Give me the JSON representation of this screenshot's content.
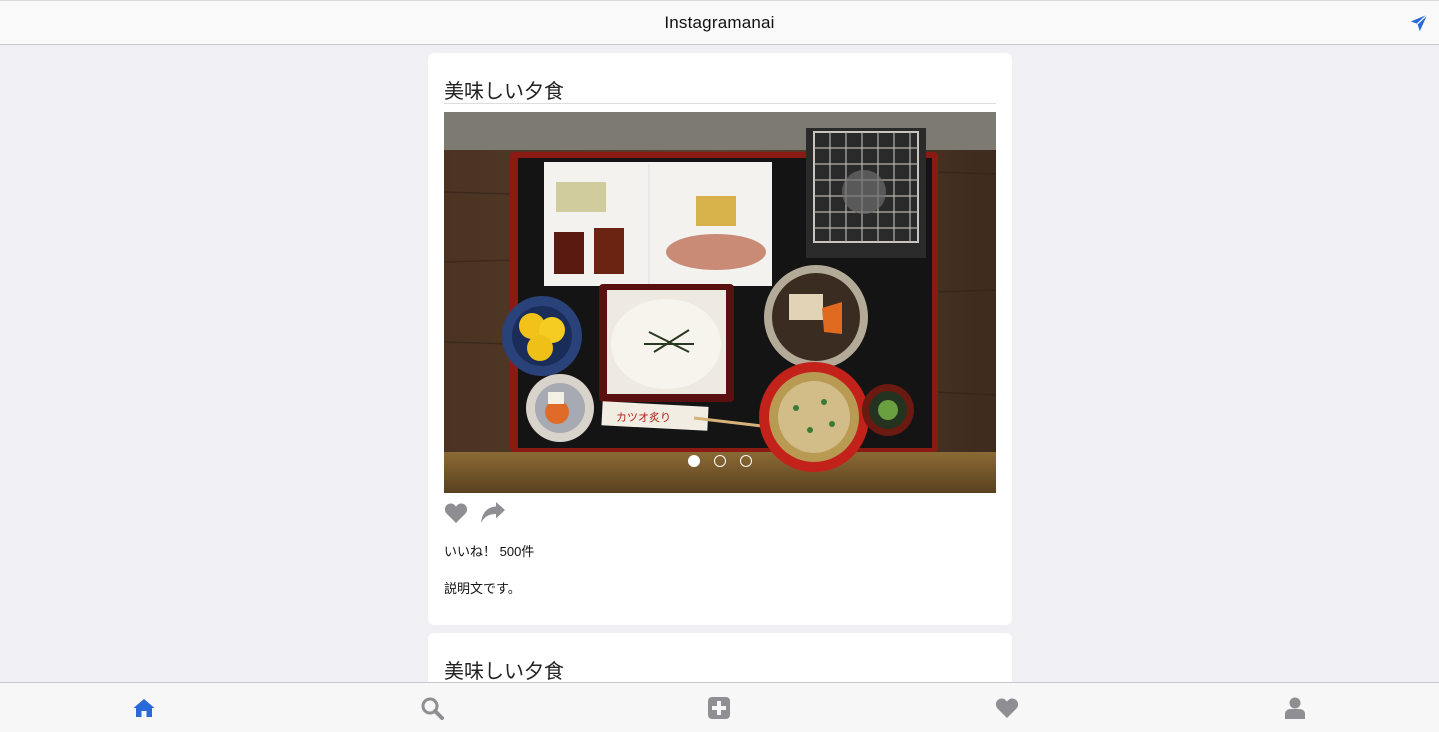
{
  "header": {
    "title": "Instagramanai",
    "send_icon": "paper-plane-icon",
    "accent_color": "#2a6ad8"
  },
  "posts": [
    {
      "title": "美味しい夕食",
      "image": "japanese-set-meal-photo",
      "carousel": {
        "count": 3,
        "active_index": 0
      },
      "actions": [
        "heart-icon",
        "share-icon"
      ],
      "likes": "いいね！ 500件",
      "description": "説明文です。"
    },
    {
      "title": "美味しい夕食"
    }
  ],
  "tabbar": {
    "items": [
      {
        "icon": "home-icon",
        "active": true
      },
      {
        "icon": "search-icon",
        "active": false
      },
      {
        "icon": "plus-square-icon",
        "active": false
      },
      {
        "icon": "heart-icon",
        "active": false
      },
      {
        "icon": "user-icon",
        "active": false
      }
    ],
    "active_color": "#2a6ad8",
    "inactive_color": "#8e8e93"
  }
}
